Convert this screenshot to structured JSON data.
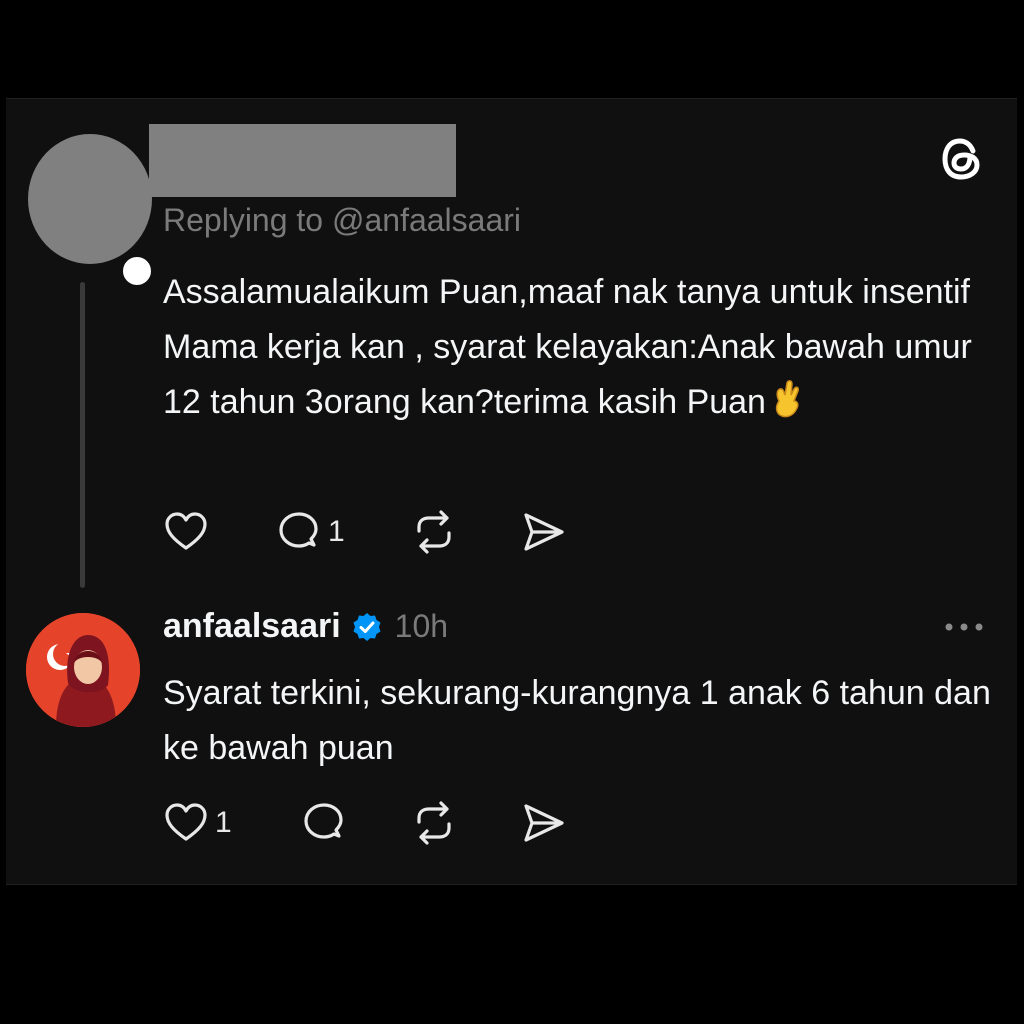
{
  "post1": {
    "replying_to": "Replying to @anfaalsaari",
    "text": "Assalamualaikum Puan,maaf nak tanya untuk insentif Mama kerja kan , syarat kelayakan:Anak bawah umur 12 tahun 3orang kan?terima kasih Puan",
    "emoji": "crossed-fingers-emoji",
    "likes": "",
    "replies": "1"
  },
  "post2": {
    "author": "anfaalsaari",
    "verified": true,
    "time": "10h",
    "text": "Syarat terkini, sekurang-kurangnya 1 anak 6 tahun dan ke bawah puan",
    "likes": "1",
    "replies": ""
  },
  "icons": {
    "logo": "threads-logo-icon",
    "like": "heart-icon",
    "reply": "comment-icon",
    "repost": "repost-icon",
    "share": "send-icon",
    "more": "more-dots-icon",
    "verified": "verified-badge-icon"
  },
  "colors": {
    "background": "#101010",
    "text": "#f3f5f7",
    "secondary": "#7a7a7a",
    "verified": "#0095f6"
  }
}
